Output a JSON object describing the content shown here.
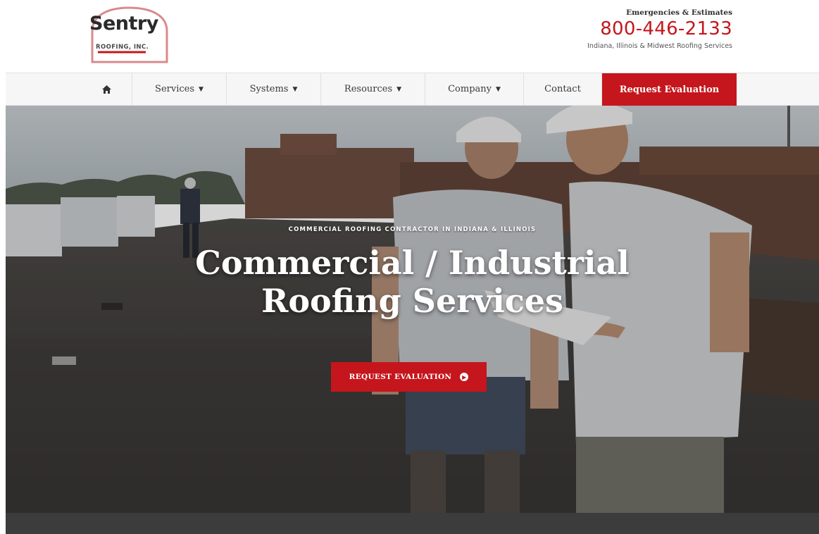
{
  "header": {
    "logo": {
      "wordmark": "Sentry",
      "subtitle": "ROOFING, INC."
    },
    "contact": {
      "label": "Emergencies & Estimates",
      "phone": "800-446-2133",
      "tagline": "Indiana, Illinois & Midwest Roofing Services"
    }
  },
  "nav": {
    "home_icon": "home-icon",
    "items": [
      {
        "label": "Services",
        "caret": "chevron-down-icon"
      },
      {
        "label": "Systems",
        "caret": "chevron-down-icon"
      },
      {
        "label": "Resources",
        "caret": "chevron-down-icon"
      },
      {
        "label": "Company",
        "caret": "chevron-down-icon"
      },
      {
        "label": "Contact"
      }
    ],
    "cta": "Request Evaluation"
  },
  "hero": {
    "eyebrow": "COMMERCIAL ROOFING CONTRACTOR IN INDIANA & ILLINOIS",
    "title_line1": "Commercial / Industrial",
    "title_line2": "Roofing Services",
    "button_label": "REQUEST EVALUATION",
    "button_icon": "arrow-circle-right-icon"
  },
  "colors": {
    "brand_red": "#c4161c",
    "nav_bg": "#f6f6f6",
    "band": "#3c3c3c"
  }
}
